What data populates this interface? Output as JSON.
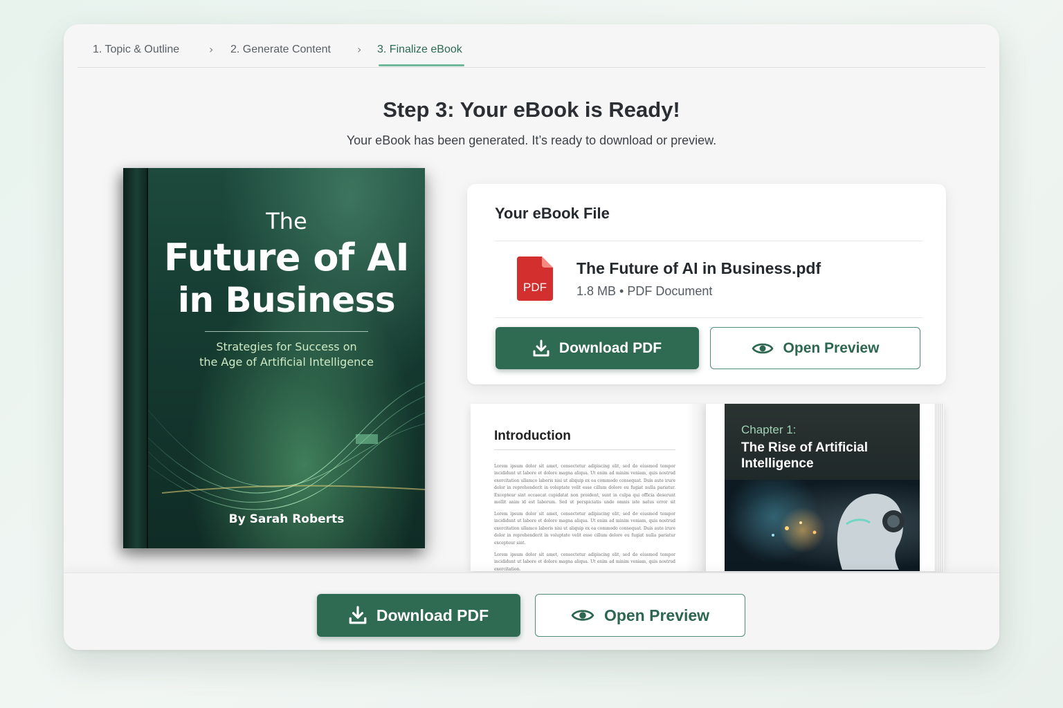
{
  "stepper": {
    "steps": [
      {
        "label": "1. Topic & Outline"
      },
      {
        "label": "2. Generate Content"
      },
      {
        "label": "3. Finalize eBook"
      }
    ]
  },
  "header": {
    "title": "Step 3: Your eBook is Ready!",
    "subtitle": "Your eBook has been generated. It’s ready to download or preview."
  },
  "book": {
    "title_line1": "The",
    "title_line2": "Future of AI",
    "title_line3": "in Business",
    "subtitle_line1": "Strategies for Success on",
    "subtitle_line2": "the Age of Artificial Intelligence",
    "author": "By Sarah Roberts"
  },
  "file_card": {
    "heading": "Your eBook File",
    "file_name": "The Future of AI in Business.pdf",
    "file_meta": "1.8 MB • PDF Document",
    "icon_label": "PDF",
    "download_label": "Download PDF",
    "preview_label": "Open Preview"
  },
  "preview": {
    "left_heading": "Introduction",
    "chapter_label": "Chapter 1:",
    "chapter_title": "The Rise of Artificial Intelligence"
  },
  "bottom_bar": {
    "download_label": "Download PDF",
    "preview_label": "Open Preview"
  },
  "colors": {
    "accent": "#2f6a53",
    "accent_light": "#6fb79a",
    "pdf_red": "#d32f2f"
  }
}
